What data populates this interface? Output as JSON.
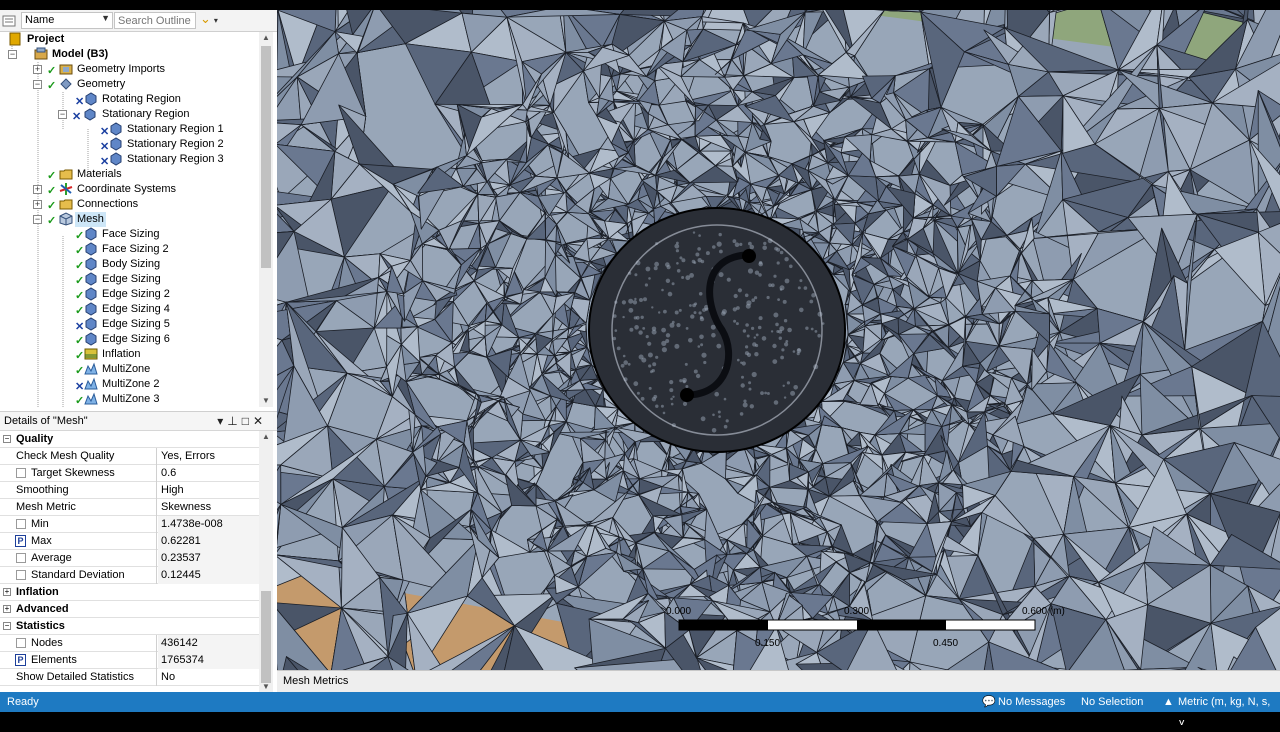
{
  "outline": {
    "name_dropdown": "Name",
    "search_placeholder": "Search Outline",
    "tree": [
      {
        "label": "Project",
        "bold": true
      },
      {
        "label": "Model (B3)",
        "bold": true
      },
      {
        "label": "Geometry Imports"
      },
      {
        "label": "Geometry"
      },
      {
        "label": "Rotating Region"
      },
      {
        "label": "Stationary Region"
      },
      {
        "label": "Stationary Region 1"
      },
      {
        "label": "Stationary Region 2"
      },
      {
        "label": "Stationary Region 3"
      },
      {
        "label": "Materials"
      },
      {
        "label": "Coordinate Systems"
      },
      {
        "label": "Connections"
      },
      {
        "label": "Mesh",
        "selected": true
      },
      {
        "label": "Face Sizing"
      },
      {
        "label": "Face Sizing 2"
      },
      {
        "label": "Body Sizing"
      },
      {
        "label": "Edge Sizing"
      },
      {
        "label": "Edge Sizing 2"
      },
      {
        "label": "Edge Sizing 4"
      },
      {
        "label": "Edge Sizing 5"
      },
      {
        "label": "Edge Sizing 6"
      },
      {
        "label": "Inflation"
      },
      {
        "label": "MultiZone"
      },
      {
        "label": "MultiZone 2"
      },
      {
        "label": "MultiZone 3"
      }
    ]
  },
  "details": {
    "title": "Details of \"Mesh\"",
    "rows": [
      {
        "section": "Quality",
        "expanded": true
      },
      {
        "key": "Check Mesh Quality",
        "value": "Yes, Errors"
      },
      {
        "key": "Target Skewness",
        "value": "0.6",
        "checkbox": true
      },
      {
        "key": "Smoothing",
        "value": "High"
      },
      {
        "key": "Mesh Metric",
        "value": "Skewness"
      },
      {
        "key": "Min",
        "value": "1.4738e-008",
        "checkbox": true,
        "readonly": true
      },
      {
        "key": "Max",
        "value": "0.62281",
        "param": true,
        "readonly": true
      },
      {
        "key": "Average",
        "value": "0.23537",
        "checkbox": true,
        "readonly": true
      },
      {
        "key": "Standard Deviation",
        "value": "0.12445",
        "checkbox": true,
        "readonly": true
      },
      {
        "section": "Inflation",
        "expanded": false
      },
      {
        "section": "Advanced",
        "expanded": false
      },
      {
        "section": "Statistics",
        "expanded": true
      },
      {
        "key": "Nodes",
        "value": "436142",
        "checkbox": true,
        "readonly": true
      },
      {
        "key": "Elements",
        "value": "1765374",
        "param": true,
        "readonly": true
      },
      {
        "key": "Show Detailed Statistics",
        "value": "No"
      }
    ]
  },
  "viewport": {
    "scale_labels": [
      "0.000",
      "0.300",
      "0.600 (m)",
      "0.150",
      "0.450"
    ],
    "tab": "Mesh Metrics"
  },
  "status": {
    "ready": "Ready",
    "messages": "No Messages",
    "selection": "No Selection",
    "units": "Metric (m, kg, N, s, V"
  },
  "colors": {
    "status_bar": "#1e7ac2",
    "mesh_face": "#98a6b8",
    "selection": "#cde6f7",
    "check_green": "#1a9a1a"
  }
}
